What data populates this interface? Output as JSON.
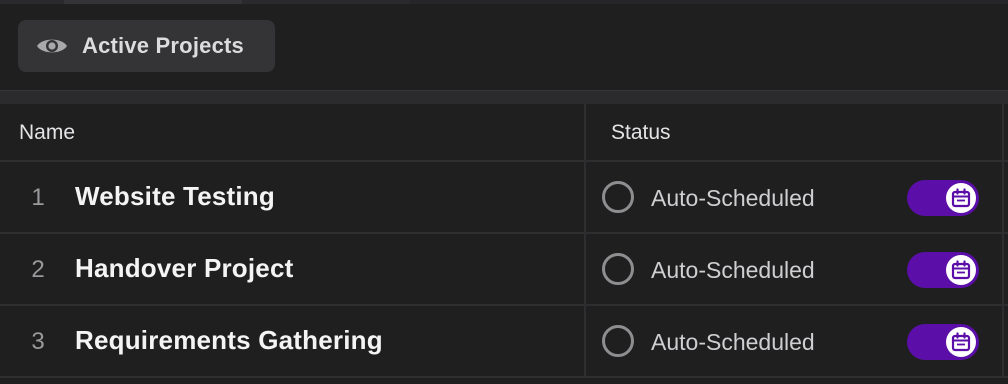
{
  "view": {
    "label": "Active Projects",
    "icon": "eye-icon"
  },
  "table": {
    "columns": [
      "Name",
      "Status"
    ],
    "rows": [
      {
        "num": "1",
        "name": "Website Testing",
        "status": "Auto-Scheduled",
        "toggle_on": true
      },
      {
        "num": "2",
        "name": "Handover Project",
        "status": "Auto-Scheduled",
        "toggle_on": true
      },
      {
        "num": "3",
        "name": "Requirements Gathering",
        "status": "Auto-Scheduled",
        "toggle_on": true
      }
    ]
  },
  "colors": {
    "background": "#1f1f20",
    "toggle_accent": "#5b0fa8",
    "chip_background": "#343436"
  }
}
